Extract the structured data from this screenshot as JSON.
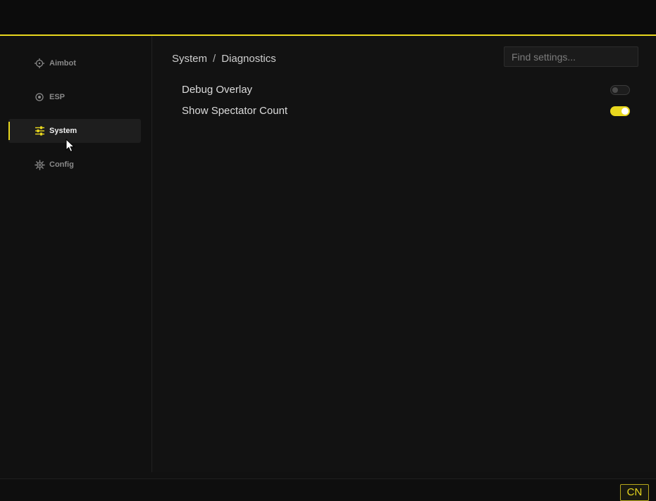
{
  "sidebar": {
    "items": [
      {
        "label": "Aimbot",
        "icon": "crosshair-icon",
        "active": false
      },
      {
        "label": "ESP",
        "icon": "target-icon",
        "active": false
      },
      {
        "label": "System",
        "icon": "sliders-icon",
        "active": true
      },
      {
        "label": "Config",
        "icon": "gear-icon",
        "active": false
      }
    ]
  },
  "main": {
    "breadcrumb": {
      "parent": "System",
      "separator": "/",
      "current": "Diagnostics"
    },
    "search": {
      "placeholder": "Find settings...",
      "value": ""
    },
    "settings": [
      {
        "label": "Debug Overlay",
        "enabled": false
      },
      {
        "label": "Show Spectator Count",
        "enabled": true
      }
    ]
  },
  "footer": {
    "language_label": "CN"
  },
  "colors": {
    "accent": "#e8d71e",
    "background": "#111111",
    "text": "#dcdcdc",
    "muted": "#8a8a8a"
  }
}
